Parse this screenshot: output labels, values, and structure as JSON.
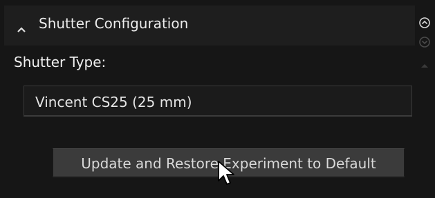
{
  "section": {
    "title": "Shutter Configuration",
    "collapse_icon": "chevron-up-icon",
    "scroll_up_icon": "circle-chevron-up-icon",
    "scroll_down_icon": "circle-chevron-down-icon",
    "scroll_thumb_icon": "triangle-up-icon"
  },
  "shutter_type": {
    "label": "Shutter Type:",
    "selected_value": "Vincent CS25 (25 mm)"
  },
  "actions": {
    "update_restore_label": "Update and Restore Experiment to Default"
  },
  "colors": {
    "background": "#161616",
    "header_background": "#1e1e1e",
    "button_background": "#3b3b3b",
    "text": "#e8e8e8"
  }
}
